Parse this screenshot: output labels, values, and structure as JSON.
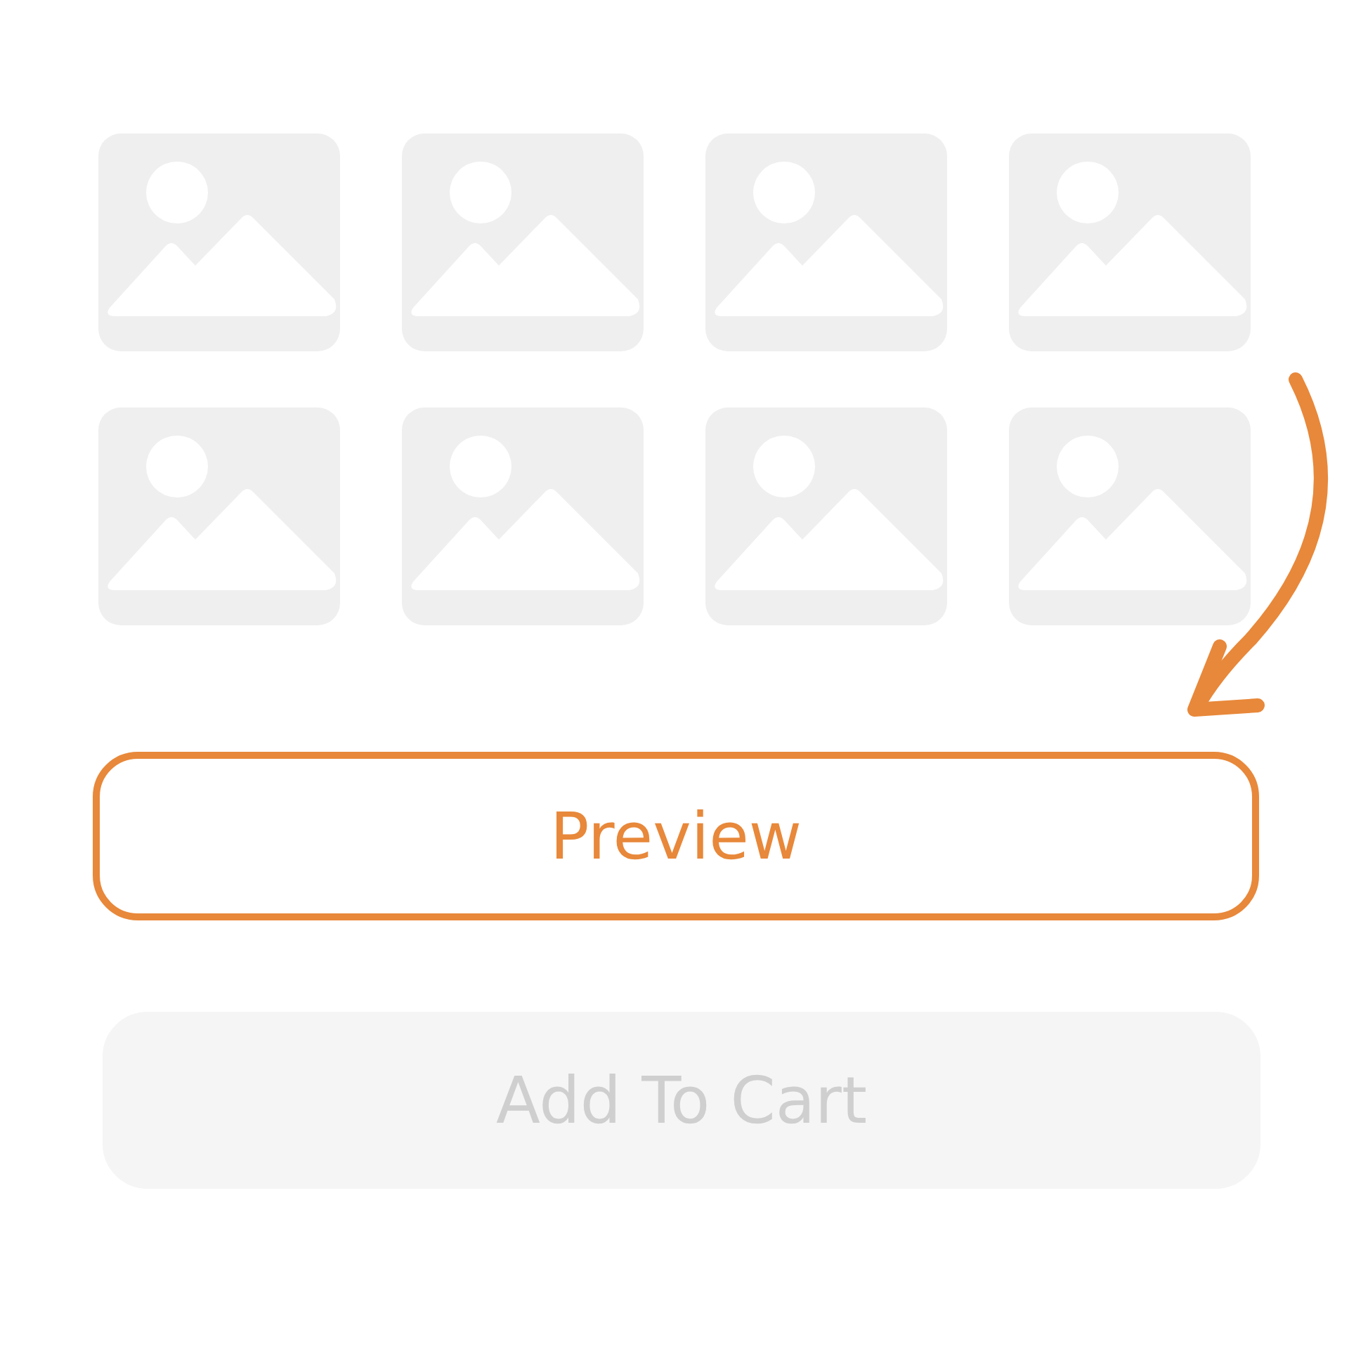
{
  "thumbnails": [
    {
      "kind": "placeholder"
    },
    {
      "kind": "placeholder"
    },
    {
      "kind": "placeholder"
    },
    {
      "kind": "placeholder"
    },
    {
      "kind": "placeholder"
    },
    {
      "kind": "placeholder"
    },
    {
      "kind": "placeholder"
    },
    {
      "kind": "placeholder"
    }
  ],
  "buttons": [
    {
      "label": "Preview",
      "highlighted": true,
      "disabled": false
    },
    {
      "label": "Add To Cart",
      "highlighted": false,
      "disabled": true
    }
  ]
}
